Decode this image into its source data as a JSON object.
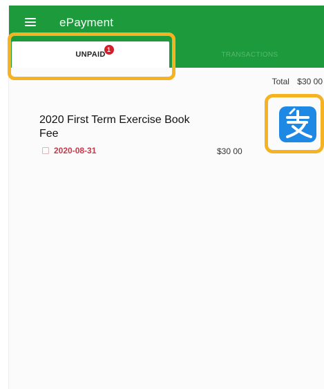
{
  "header": {
    "title": "ePayment",
    "menu_icon": "hamburger-menu-icon"
  },
  "tabs": [
    {
      "label": "UNPAID",
      "badge": "1",
      "active": true
    },
    {
      "label": "TRANSACTIONS",
      "active": false
    }
  ],
  "summary": {
    "total_label": "Total",
    "total_value": "$30 00"
  },
  "items": [
    {
      "title": "2020 First Term Exercise Book Fee",
      "date": "2020-08-31",
      "amount": "$30 00",
      "pay_icon": "alipay-icon"
    }
  ],
  "colors": {
    "header_bg": "#1c9a3c",
    "highlight": "#f5b323",
    "badge": "#d21f2b",
    "date_text": "#c4394a",
    "alipay_blue": "#1e88e5"
  }
}
